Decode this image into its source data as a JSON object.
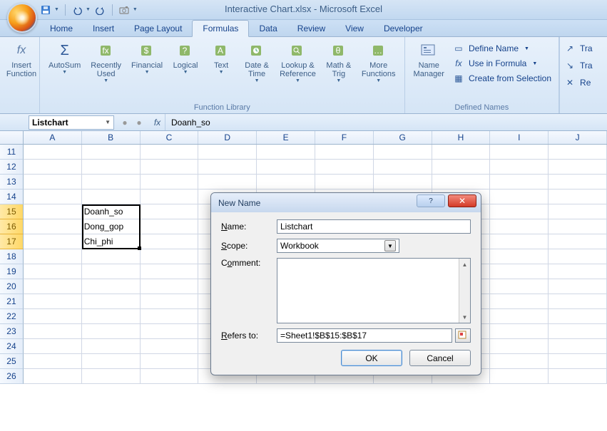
{
  "window": {
    "title": "Interactive Chart.xlsx - Microsoft Excel"
  },
  "tabs": [
    "Home",
    "Insert",
    "Page Layout",
    "Formulas",
    "Data",
    "Review",
    "View",
    "Developer"
  ],
  "active_tab": "Formulas",
  "ribbon": {
    "insert_function": "Insert\nFunction",
    "library": {
      "autosum": "AutoSum",
      "recent": "Recently\nUsed",
      "financial": "Financial",
      "logical": "Logical",
      "text": "Text",
      "datetime": "Date &\nTime",
      "lookup": "Lookup &\nReference",
      "math": "Math &\nTrig",
      "more": "More\nFunctions",
      "group_label": "Function Library"
    },
    "names": {
      "manager": "Name\nManager",
      "define": "Define Name",
      "use": "Use in Formula",
      "create": "Create from Selection",
      "group_label": "Defined Names"
    },
    "right": {
      "tra1": "Tra",
      "tra2": "Tra",
      "re": "Re"
    }
  },
  "formula_bar": {
    "name_box": "Listchart",
    "fx_label": "fx",
    "value": "Doanh_so"
  },
  "grid": {
    "columns": [
      "A",
      "B",
      "C",
      "D",
      "E",
      "F",
      "G",
      "H",
      "I",
      "J"
    ],
    "first_row": 11,
    "last_row": 26,
    "selected_rows": [
      15,
      16,
      17
    ],
    "data": {
      "B15": "Doanh_so",
      "B16": "Dong_gop",
      "B17": "Chi_phi"
    }
  },
  "dialog": {
    "title": "New Name",
    "labels": {
      "name": "Name:",
      "scope": "Scope:",
      "comment": "Comment:",
      "refers": "Refers to:"
    },
    "fields": {
      "name": "Listchart",
      "scope": "Workbook",
      "refers": "=Sheet1!$B$15:$B$17"
    },
    "buttons": {
      "ok": "OK",
      "cancel": "Cancel"
    }
  }
}
